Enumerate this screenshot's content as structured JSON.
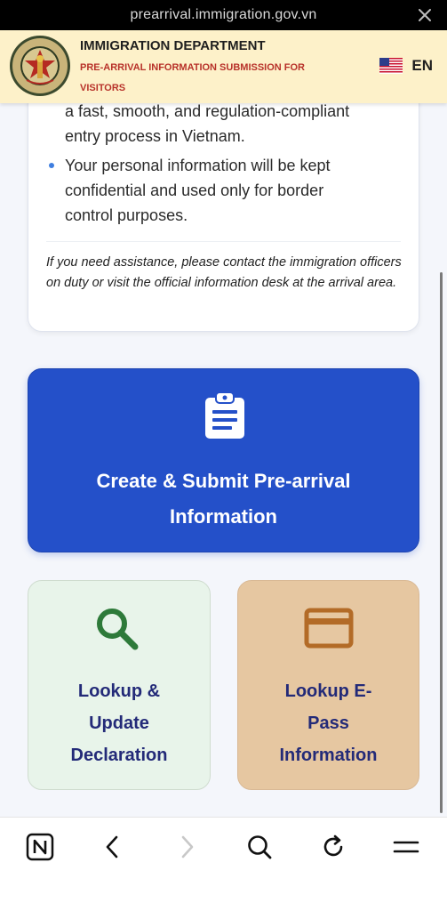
{
  "browser": {
    "url": "prearrival.immigration.gov.vn"
  },
  "header": {
    "title": "IMMIGRATION DEPARTMENT",
    "subtitle": "PRE-ARRIVAL INFORMATION SUBMISSION FOR VISITORS",
    "logo_text": "QUẢN LÝ XUẤT NHẬP CẢNH IMMIGRATION",
    "language": "EN"
  },
  "info": {
    "bullet1_line1": "a fast, smooth, and regulation-compliant",
    "bullet1_line2": "entry process in Vietnam.",
    "bullet2_line1": "Your personal information will be kept",
    "bullet2_line2": "confidential and used only for border",
    "bullet2_line3": "control purposes.",
    "note": "If you need assistance, please contact the immigration officers on duty or visit the official information desk at the arrival area."
  },
  "actions": {
    "create_label": "Create & Submit Pre-arrival Information",
    "lookup_label": "Lookup & Update Declaration",
    "epass_label": "Lookup E-Pass Information"
  },
  "icons": {
    "create": "clipboard-icon",
    "lookup": "search-icon",
    "epass": "card-icon"
  },
  "colors": {
    "primary": "#2450c9",
    "lookup_bg": "#e8f4ea",
    "epass_bg": "#e6c7a1",
    "header_bg": "#fdf1c9",
    "label_dark": "#232a78"
  }
}
